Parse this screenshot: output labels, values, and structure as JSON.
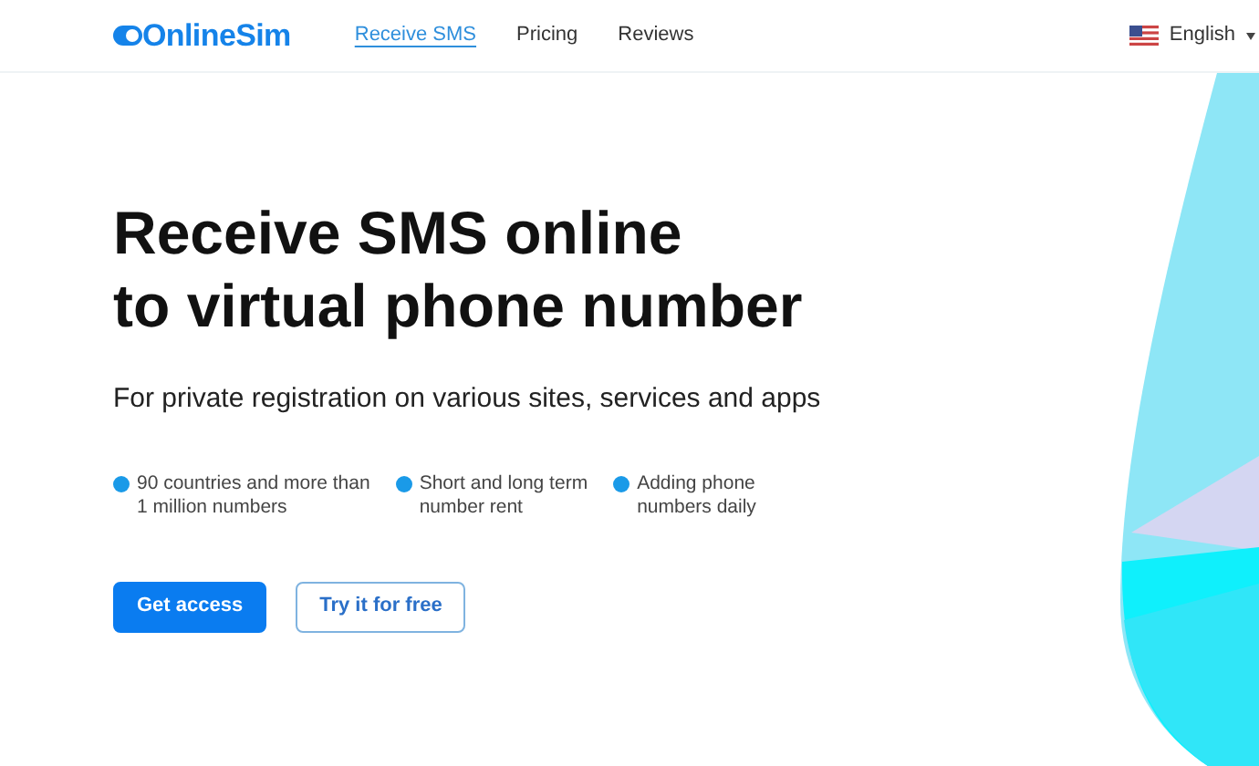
{
  "header": {
    "logo": "OnlineSim",
    "nav": [
      {
        "label": "Receive SMS",
        "selected": true
      },
      {
        "label": "Pricing",
        "selected": false
      },
      {
        "label": "Reviews",
        "selected": false
      }
    ],
    "language": "English"
  },
  "hero": {
    "title_lines": [
      "Receive SMS online",
      "to virtual phone number"
    ],
    "subtitle": "For private registration on various sites, services and apps",
    "features": [
      {
        "lines": [
          "90 countries and more than",
          "1 million numbers"
        ]
      },
      {
        "lines": [
          "Short and long term",
          "number rent"
        ]
      },
      {
        "lines": [
          "Adding phone",
          "numbers daily"
        ]
      }
    ],
    "buttons": [
      {
        "label": "Get access",
        "kind": "primary"
      },
      {
        "label": "Try it for free",
        "kind": "outline"
      }
    ]
  }
}
